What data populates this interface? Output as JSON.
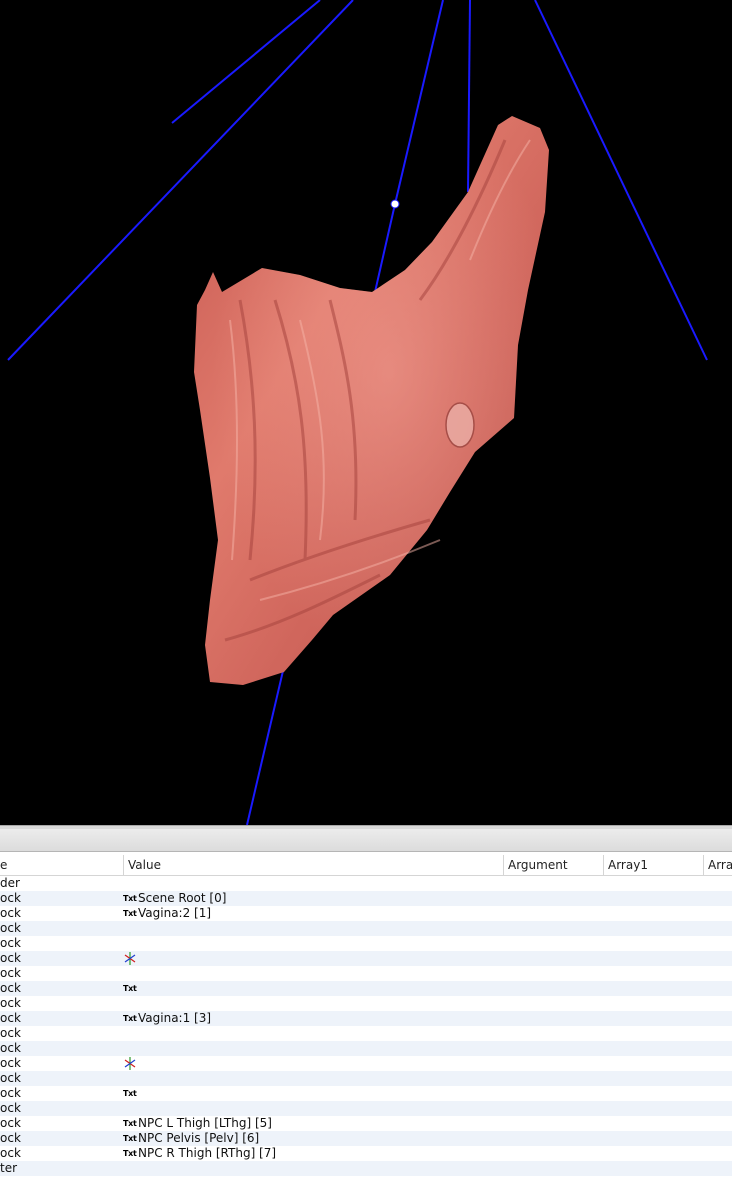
{
  "viewport": {
    "background": "#000000",
    "mesh_color": "#d46a5f",
    "line_color": "#1a1aff"
  },
  "table": {
    "columns": [
      "e",
      "Value",
      "Argument",
      "Array1",
      "Array"
    ],
    "rows": [
      {
        "type": "der",
        "icon": "",
        "value": ""
      },
      {
        "type": "ock",
        "icon": "text-icon",
        "value": "Scene Root [0]"
      },
      {
        "type": "ock",
        "icon": "text-icon",
        "value": "Vagina:2 [1]"
      },
      {
        "type": "ock",
        "icon": "",
        "value": ""
      },
      {
        "type": "ock",
        "icon": "",
        "value": ""
      },
      {
        "type": "ock",
        "icon": "axis-icon",
        "value": ""
      },
      {
        "type": "ock",
        "icon": "",
        "value": ""
      },
      {
        "type": "ock",
        "icon": "text-icon",
        "value": ""
      },
      {
        "type": "ock",
        "icon": "",
        "value": ""
      },
      {
        "type": "ock",
        "icon": "text-icon",
        "value": "Vagina:1 [3]"
      },
      {
        "type": "ock",
        "icon": "",
        "value": ""
      },
      {
        "type": "ock",
        "icon": "",
        "value": ""
      },
      {
        "type": "ock",
        "icon": "axis-icon",
        "value": ""
      },
      {
        "type": "ock",
        "icon": "",
        "value": ""
      },
      {
        "type": "ock",
        "icon": "text-icon",
        "value": ""
      },
      {
        "type": "ock",
        "icon": "",
        "value": ""
      },
      {
        "type": "ock",
        "icon": "text-icon",
        "value": "NPC L Thigh [LThg] [5]"
      },
      {
        "type": "ock",
        "icon": "text-icon",
        "value": "NPC Pelvis [Pelv] [6]"
      },
      {
        "type": "ock",
        "icon": "text-icon",
        "value": "NPC R Thigh [RThg] [7]"
      },
      {
        "type": "ter",
        "icon": "",
        "value": ""
      }
    ]
  },
  "icons": {
    "text_icon_label": "Txt"
  }
}
